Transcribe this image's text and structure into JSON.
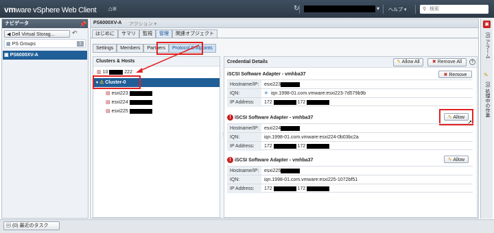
{
  "app": {
    "brand": "vm",
    "brand2": "ware",
    "title": " vSphere Web Client",
    "help": "ヘルプ ▾",
    "search_placeholder": "検索"
  },
  "nav": {
    "title": "ナビゲータ",
    "back_label": "◀ Dell Virtual Storag...",
    "ps_groups_label": "PS Groups",
    "ps_groups_count": "1",
    "selected_item": "PS6000XV-A"
  },
  "workspace": {
    "object_title": "PS6000XV-A",
    "actions": "アクション ▾",
    "tabs": [
      "はじめに",
      "サマリ",
      "監視",
      "管理",
      "関連オブジェクト"
    ],
    "subtabs": [
      "Settings",
      "Members",
      "Partners",
      "Protocol Endpoints"
    ],
    "clusters_title": "Clusters & Hosts",
    "tree_top": "10",
    "tree_top_suffix": "222",
    "cluster": "Cluster-0",
    "hosts": [
      "esxi223",
      "esxi224",
      "esxi225"
    ],
    "cred_title": "Credential Details",
    "allow_all": "Allow All",
    "remove_all": "Remove All",
    "help_q": "?"
  },
  "cards": [
    {
      "title": "iSCSI Software Adapter - vmhba37",
      "warn": false,
      "action": "Remove",
      "hostname": "esxi223",
      "iqn": "iqn.1998-01.com.vmware:esxi223-7d579b9b",
      "iqn_icon": true,
      "ip1": "172",
      "ip2": "172"
    },
    {
      "title": "iSCSI Software Adapter - vmhba37",
      "warn": true,
      "action": "Allow",
      "hostname": "esxi224",
      "iqn": "iqn.1998-01.com.vmware:esxi224-0b03bc2a",
      "iqn_icon": false,
      "ip1": "172",
      "ip2": "172"
    },
    {
      "title": "iSCSI Software Adapter - vmhba37",
      "warn": true,
      "action": "Allow",
      "hostname": "esxi225",
      "iqn": "iqn.1998-01.com.vmware:esxi225-1072bf51",
      "iqn_icon": false,
      "ip1": "172",
      "ip2": "172"
    }
  ],
  "labels": {
    "hostname": "Hostname/IP:",
    "iqn": "IQN:",
    "ip": "IP Address:"
  },
  "bottom": {
    "tasks_count": "(0)",
    "tasks_label": "最近のタスク"
  },
  "right": {
    "alarms": "(0) 処理中の作業"
  }
}
